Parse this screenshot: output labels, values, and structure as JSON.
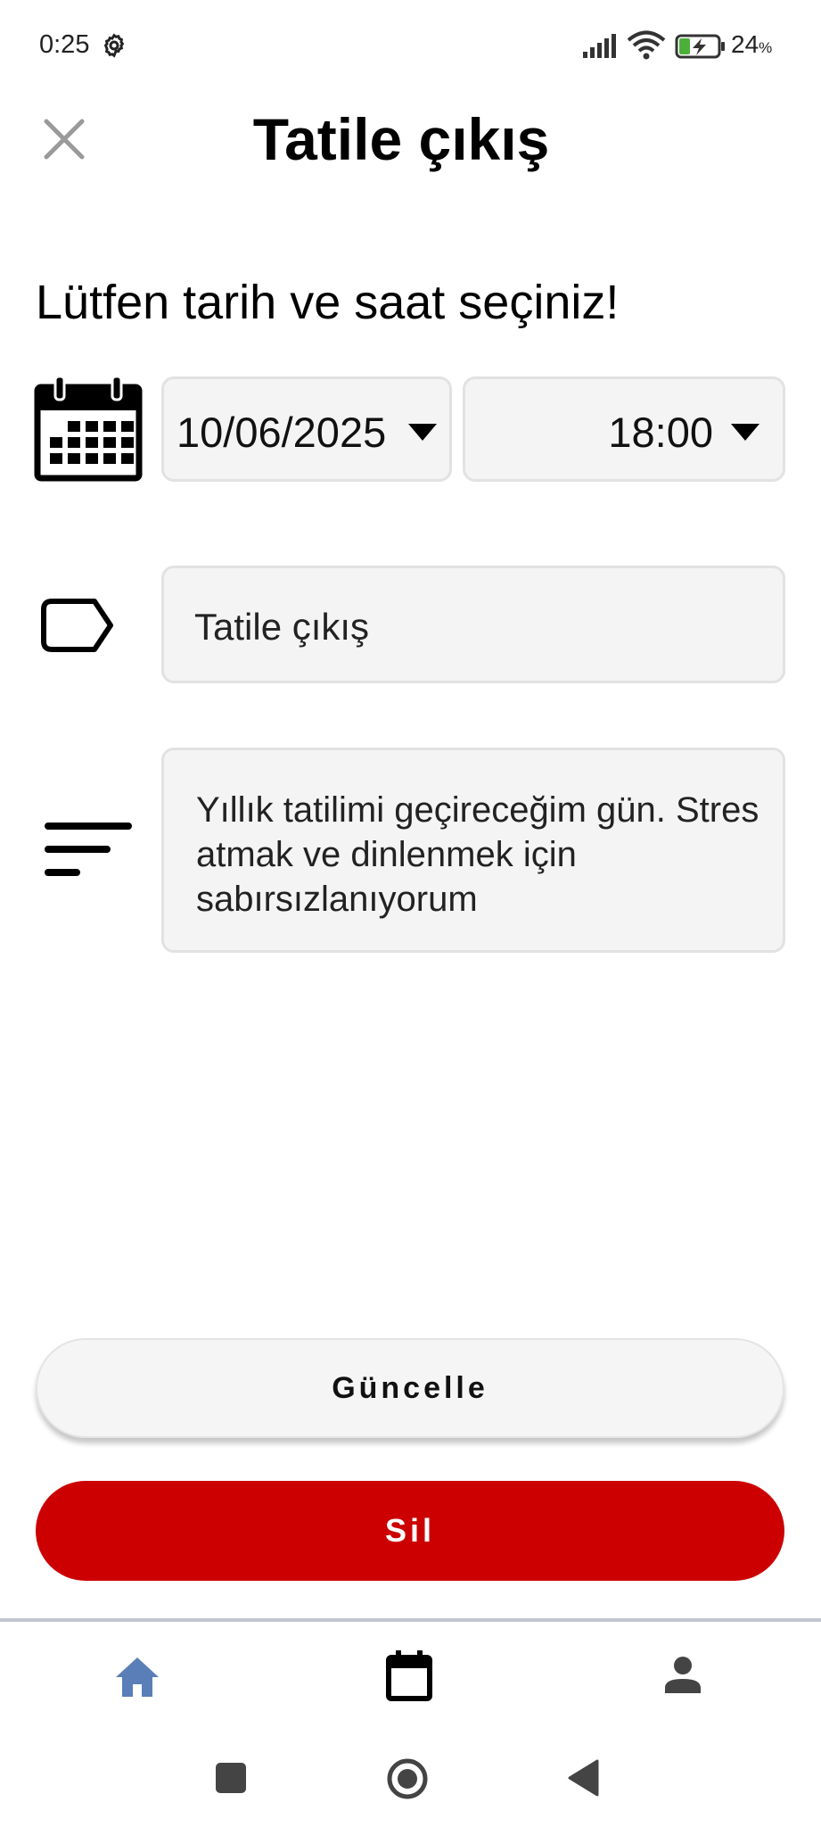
{
  "status_bar": {
    "time": "0:25",
    "battery_percent": "24",
    "battery_unit": "%",
    "icons": [
      "gear-icon",
      "signal-icon",
      "wifi-icon",
      "battery-charging-icon"
    ]
  },
  "header": {
    "title": "Tatile çıkış",
    "close_icon": "close-icon"
  },
  "form": {
    "prompt": "Lütfen tarih ve saat seçiniz!",
    "date_value": "10/06/2025",
    "time_value": "18:00",
    "title_value": "Tatile çıkış",
    "description_value": "Yıllık tatilimi geçireceğim gün. Stres atmak ve dinlenmek için sabırsızlanıyorum"
  },
  "actions": {
    "update_label": "Güncelle",
    "delete_label": "Sil"
  },
  "bottom_nav": {
    "items": [
      "home-icon",
      "calendar-icon",
      "profile-icon"
    ],
    "active": "home-icon",
    "active_color": "#5a7fb8"
  },
  "colors": {
    "delete_button": "#cc0000",
    "field_background": "#f4f4f4"
  }
}
